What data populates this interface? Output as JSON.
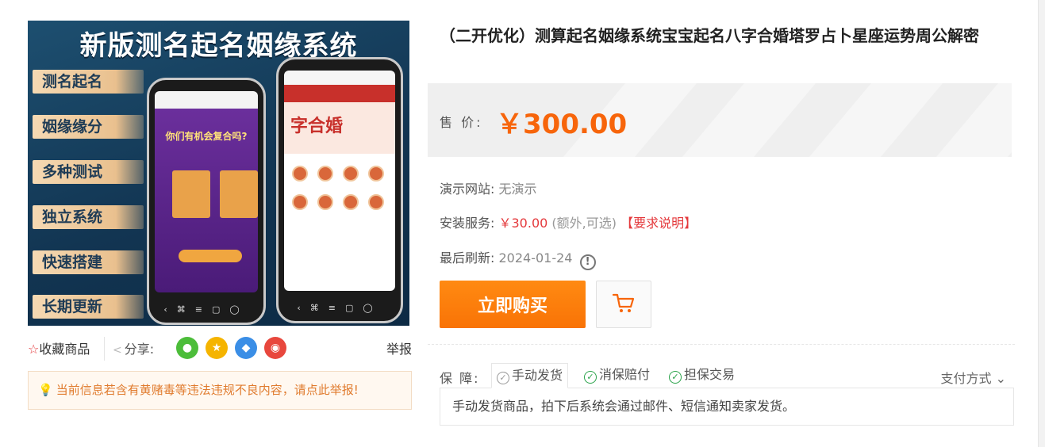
{
  "gallery": {
    "banner_title": "新版测名起名姻缘系统",
    "features": [
      "测名起名",
      "姻缘缘分",
      "多种测试",
      "独立系统",
      "快速搭建",
      "长期更新"
    ],
    "phone1_headline": "你们有机会复合吗?",
    "phone2_headline": "字合婚"
  },
  "actions": {
    "favorite_label": "收藏商品",
    "share_label": "分享:",
    "report_label": "举报",
    "share_channels": [
      {
        "name": "wechat-icon",
        "color": "#4cbd3a",
        "glyph": "●"
      },
      {
        "name": "qzone-icon",
        "color": "#f5b400",
        "glyph": "★"
      },
      {
        "name": "qq-icon",
        "color": "#3a8ee6",
        "glyph": "◆"
      },
      {
        "name": "weibo-icon",
        "color": "#e8473d",
        "glyph": "◉"
      }
    ]
  },
  "notice": "当前信息若含有黄赌毒等违法违规不良内容，请点此举报!",
  "product": {
    "title": "（二开优化）测算起名姻缘系统宝宝起名八字合婚塔罗占卜星座运势周公解密",
    "price_label": "售  价:",
    "price": "￥300.00"
  },
  "details": {
    "demo_label": "演示网站:",
    "demo_value": "无演示",
    "install_label": "安装服务:",
    "install_price": "￥30.00",
    "install_note": "(额外,可选)",
    "install_link": "【要求说明】",
    "refresh_label": "最后刷新:",
    "refresh_date": "2024-01-24"
  },
  "buttons": {
    "buy": "立即购买"
  },
  "guarantee": {
    "label": "保  障:",
    "items": [
      "手动发货",
      "消保赔付",
      "担保交易"
    ],
    "payment": "支付方式",
    "description": "手动发货商品，拍下后系统会通过邮件、短信通知卖家发货。"
  },
  "colors": {
    "accent": "#f7650b",
    "danger": "#e4393c",
    "check": "#2aa34a"
  }
}
